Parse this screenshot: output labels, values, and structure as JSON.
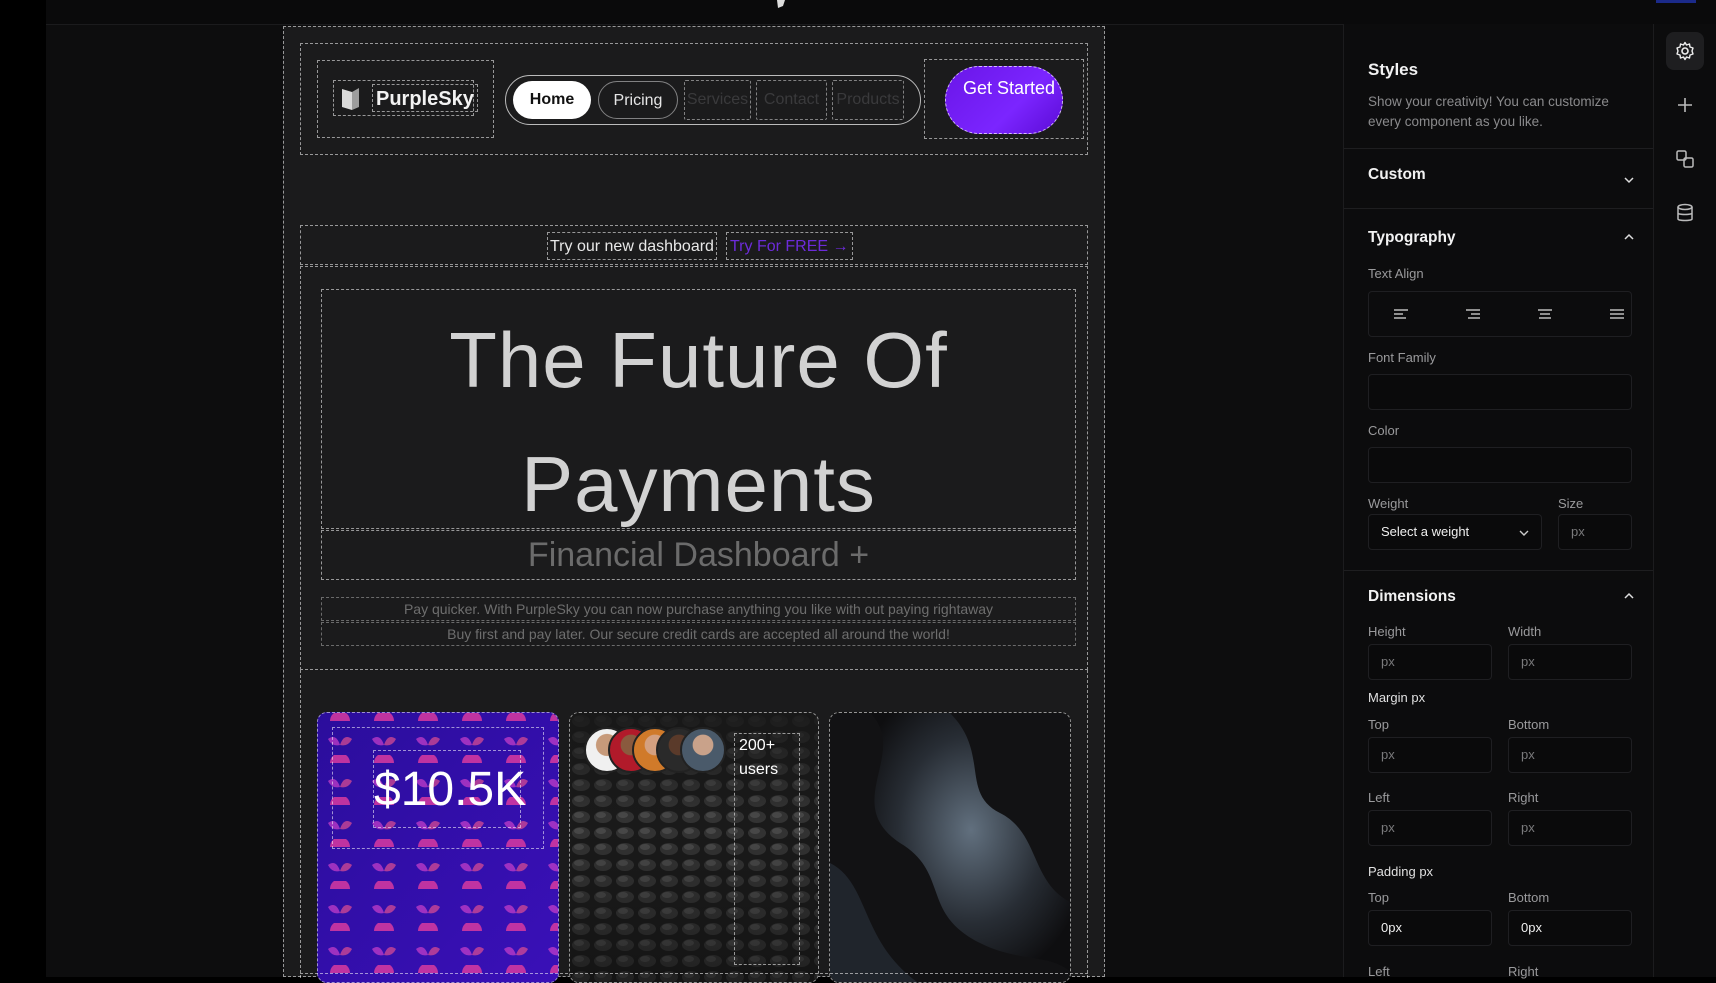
{
  "canvas": {
    "brand": {
      "name": "PurpleSky"
    },
    "nav": {
      "home": "Home",
      "pricing": "Pricing",
      "services": "Services",
      "contact": "Contact",
      "products": "Products"
    },
    "cta": {
      "label": "Get Started"
    },
    "announce": {
      "text": "Try our new dashboard",
      "link": "Try For FREE →"
    },
    "hero": {
      "headline_line1": "The Future Of",
      "headline_line2": "Payments",
      "subheadline": "Financial Dashboard +",
      "description_line1": "Pay quicker. With PurpleSky you can now purchase anything you like with out paying rightaway",
      "description_line2": "Buy first and pay later. Our secure credit cards are accepted all around the world!"
    },
    "cards": {
      "value": "$10.5K",
      "users": "200+ users"
    }
  },
  "panel": {
    "title": "Styles",
    "subtitle": "Show your creativity! You can customize every component as you like.",
    "custom": {
      "label": "Custom"
    },
    "typography": {
      "label": "Typography",
      "text_align": "Text Align",
      "font_family": "Font Family",
      "color": "Color",
      "weight": "Weight",
      "weight_placeholder": "Select a weight",
      "size": "Size",
      "size_placeholder": "px"
    },
    "dimensions": {
      "label": "Dimensions",
      "height": "Height",
      "width": "Width",
      "unit_placeholder": "px",
      "margin_label": "Margin px",
      "padding_label": "Padding px",
      "top": "Top",
      "bottom": "Bottom",
      "left": "Left",
      "right": "Right",
      "padding_top_value": "0px",
      "padding_bottom_value": "0px"
    }
  },
  "colors": {
    "accent_purple": "#7b25ff",
    "card_blue": "#2a0f9a",
    "panel_bg": "#0c0c0d"
  }
}
